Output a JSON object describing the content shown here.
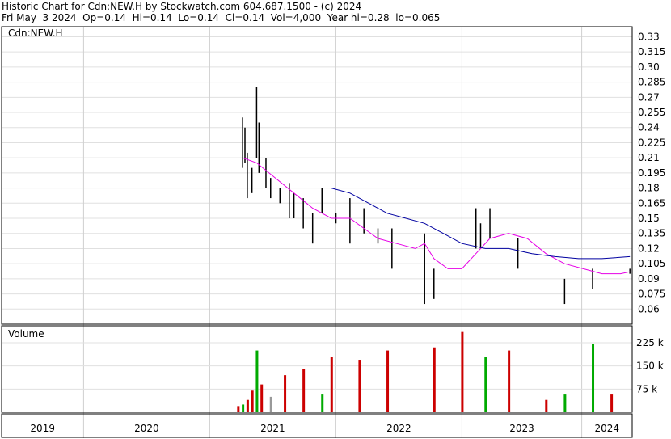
{
  "header": {
    "title": "Historic Chart for Cdn:NEW.H by Stockwatch.com 604.687.1500 - (c) 2024",
    "summary": "Fri May  3 2024  Op=0.14  Hi=0.14  Lo=0.14  Cl=0.14  Vol=4,000  Year hi=0.28  lo=0.065"
  },
  "chart_data": [
    {
      "type": "line",
      "panel_label": "Cdn:NEW.H",
      "ylim": [
        0.045,
        0.34
      ],
      "y_ticks": [
        "0.33",
        "0.315",
        "0.30",
        "0.285",
        "0.27",
        "0.255",
        "0.24",
        "0.225",
        "0.21",
        "0.195",
        "0.18",
        "0.165",
        "0.15",
        "0.135",
        "0.12",
        "0.105",
        "0.09",
        "0.075",
        "0.06"
      ],
      "colors": {
        "ma_short": "#e600e6",
        "ma_long": "#0000a0",
        "bars_up": "#000000",
        "dots": "#cc0000"
      },
      "x_years": [
        "2019",
        "2020",
        "2021",
        "2022",
        "2023",
        "2024"
      ],
      "price_bars": [
        {
          "x": 0.03,
          "hi": 0.25,
          "lo": 0.2
        },
        {
          "x": 0.035,
          "hi": 0.24,
          "lo": 0.205
        },
        {
          "x": 0.04,
          "hi": 0.215,
          "lo": 0.17
        },
        {
          "x": 0.05,
          "hi": 0.2,
          "lo": 0.175
        },
        {
          "x": 0.06,
          "hi": 0.28,
          "lo": 0.21
        },
        {
          "x": 0.065,
          "hi": 0.245,
          "lo": 0.195
        },
        {
          "x": 0.08,
          "hi": 0.21,
          "lo": 0.18
        },
        {
          "x": 0.09,
          "hi": 0.19,
          "lo": 0.17
        },
        {
          "x": 0.11,
          "hi": 0.18,
          "lo": 0.165
        },
        {
          "x": 0.13,
          "hi": 0.185,
          "lo": 0.15
        },
        {
          "x": 0.14,
          "hi": 0.175,
          "lo": 0.15
        },
        {
          "x": 0.16,
          "hi": 0.17,
          "lo": 0.14
        },
        {
          "x": 0.18,
          "hi": 0.155,
          "lo": 0.125
        },
        {
          "x": 0.2,
          "hi": 0.18,
          "lo": 0.155
        },
        {
          "x": 0.23,
          "hi": 0.155,
          "lo": 0.145
        },
        {
          "x": 0.26,
          "hi": 0.17,
          "lo": 0.125
        },
        {
          "x": 0.29,
          "hi": 0.16,
          "lo": 0.135
        },
        {
          "x": 0.32,
          "hi": 0.14,
          "lo": 0.125
        },
        {
          "x": 0.35,
          "hi": 0.14,
          "lo": 0.1
        },
        {
          "x": 0.42,
          "hi": 0.135,
          "lo": 0.065
        },
        {
          "x": 0.44,
          "hi": 0.1,
          "lo": 0.07
        },
        {
          "x": 0.53,
          "hi": 0.16,
          "lo": 0.12
        },
        {
          "x": 0.54,
          "hi": 0.145,
          "lo": 0.12
        },
        {
          "x": 0.56,
          "hi": 0.16,
          "lo": 0.13
        },
        {
          "x": 0.62,
          "hi": 0.13,
          "lo": 0.1
        },
        {
          "x": 0.72,
          "hi": 0.09,
          "lo": 0.065
        },
        {
          "x": 0.78,
          "hi": 0.1,
          "lo": 0.08
        },
        {
          "x": 0.86,
          "hi": 0.1,
          "lo": 0.095
        }
      ],
      "ma_short": [
        [
          0.03,
          0.21
        ],
        [
          0.06,
          0.205
        ],
        [
          0.1,
          0.19
        ],
        [
          0.14,
          0.175
        ],
        [
          0.18,
          0.16
        ],
        [
          0.22,
          0.15
        ],
        [
          0.26,
          0.15
        ],
        [
          0.29,
          0.14
        ],
        [
          0.32,
          0.13
        ],
        [
          0.36,
          0.125
        ],
        [
          0.4,
          0.12
        ],
        [
          0.42,
          0.125
        ],
        [
          0.44,
          0.11
        ],
        [
          0.47,
          0.1
        ],
        [
          0.5,
          0.1
        ],
        [
          0.53,
          0.115
        ],
        [
          0.56,
          0.13
        ],
        [
          0.6,
          0.135
        ],
        [
          0.64,
          0.13
        ],
        [
          0.68,
          0.115
        ],
        [
          0.72,
          0.105
        ],
        [
          0.76,
          0.1
        ],
        [
          0.8,
          0.095
        ],
        [
          0.84,
          0.095
        ],
        [
          0.86,
          0.097
        ]
      ],
      "ma_long": [
        [
          0.22,
          0.18
        ],
        [
          0.26,
          0.175
        ],
        [
          0.3,
          0.165
        ],
        [
          0.34,
          0.155
        ],
        [
          0.38,
          0.15
        ],
        [
          0.42,
          0.145
        ],
        [
          0.46,
          0.135
        ],
        [
          0.5,
          0.125
        ],
        [
          0.55,
          0.12
        ],
        [
          0.6,
          0.12
        ],
        [
          0.65,
          0.115
        ],
        [
          0.7,
          0.112
        ],
        [
          0.75,
          0.11
        ],
        [
          0.8,
          0.11
        ],
        [
          0.86,
          0.112
        ]
      ]
    },
    {
      "type": "bar",
      "panel_label": "Volume",
      "ylim": [
        0,
        280000
      ],
      "y_ticks": [
        "225 k",
        "150 k",
        "75 k"
      ],
      "colors": {
        "up": "#00aa00",
        "down": "#cc0000",
        "flat": "#999999"
      },
      "volumes": [
        {
          "x": 0.02,
          "v": 20000,
          "c": "down"
        },
        {
          "x": 0.03,
          "v": 25000,
          "c": "up"
        },
        {
          "x": 0.04,
          "v": 40000,
          "c": "down"
        },
        {
          "x": 0.05,
          "v": 70000,
          "c": "down"
        },
        {
          "x": 0.06,
          "v": 200000,
          "c": "up"
        },
        {
          "x": 0.07,
          "v": 90000,
          "c": "down"
        },
        {
          "x": 0.09,
          "v": 50000,
          "c": "flat"
        },
        {
          "x": 0.12,
          "v": 120000,
          "c": "down"
        },
        {
          "x": 0.16,
          "v": 140000,
          "c": "down"
        },
        {
          "x": 0.2,
          "v": 60000,
          "c": "up"
        },
        {
          "x": 0.22,
          "v": 180000,
          "c": "down"
        },
        {
          "x": 0.28,
          "v": 170000,
          "c": "down"
        },
        {
          "x": 0.34,
          "v": 200000,
          "c": "down"
        },
        {
          "x": 0.44,
          "v": 210000,
          "c": "down"
        },
        {
          "x": 0.5,
          "v": 260000,
          "c": "down"
        },
        {
          "x": 0.55,
          "v": 180000,
          "c": "up"
        },
        {
          "x": 0.6,
          "v": 200000,
          "c": "down"
        },
        {
          "x": 0.68,
          "v": 40000,
          "c": "down"
        },
        {
          "x": 0.72,
          "v": 60000,
          "c": "up"
        },
        {
          "x": 0.78,
          "v": 220000,
          "c": "up"
        },
        {
          "x": 0.82,
          "v": 60000,
          "c": "down"
        }
      ]
    }
  ]
}
